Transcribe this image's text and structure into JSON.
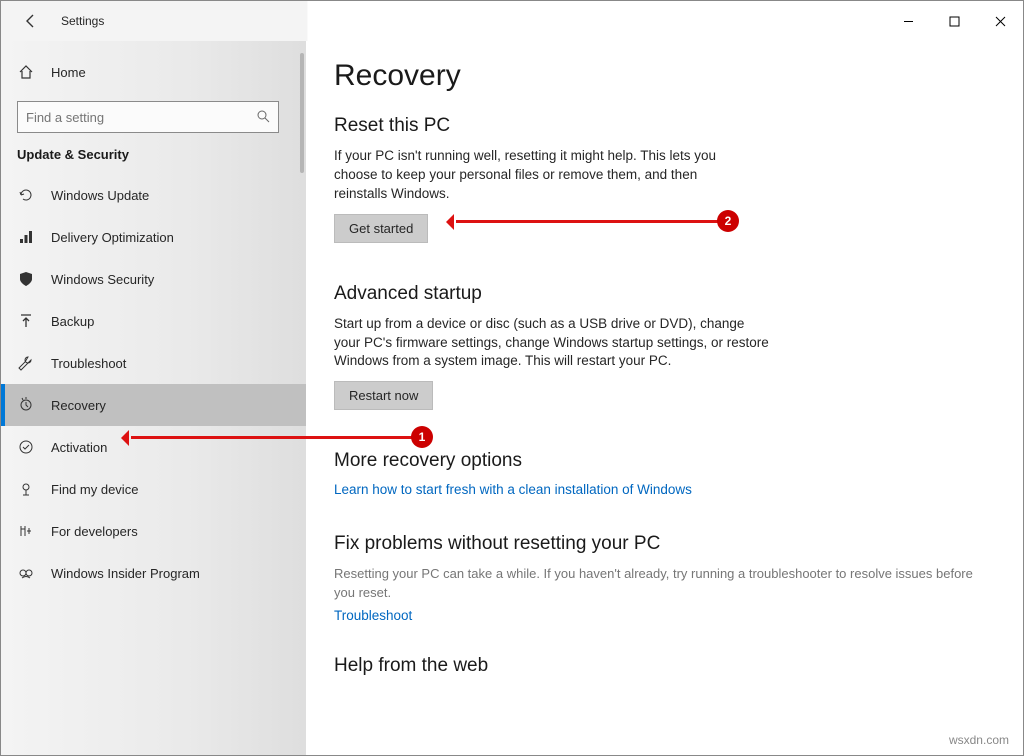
{
  "window": {
    "title": "Settings"
  },
  "sidebar": {
    "home": "Home",
    "search_placeholder": "Find a setting",
    "category": "Update & Security",
    "items": [
      {
        "label": "Windows Update"
      },
      {
        "label": "Delivery Optimization"
      },
      {
        "label": "Windows Security"
      },
      {
        "label": "Backup"
      },
      {
        "label": "Troubleshoot"
      },
      {
        "label": "Recovery"
      },
      {
        "label": "Activation"
      },
      {
        "label": "Find my device"
      },
      {
        "label": "For developers"
      },
      {
        "label": "Windows Insider Program"
      }
    ]
  },
  "page": {
    "title": "Recovery",
    "reset": {
      "heading": "Reset this PC",
      "body": "If your PC isn't running well, resetting it might help. This lets you choose to keep your personal files or remove them, and then reinstalls Windows.",
      "button": "Get started"
    },
    "advanced": {
      "heading": "Advanced startup",
      "body": "Start up from a device or disc (such as a USB drive or DVD), change your PC's firmware settings, change Windows startup settings, or restore Windows from a system image. This will restart your PC.",
      "button": "Restart now"
    },
    "more": {
      "heading": "More recovery options",
      "link": "Learn how to start fresh with a clean installation of Windows"
    },
    "fix": {
      "heading": "Fix problems without resetting your PC",
      "body": "Resetting your PC can take a while. If you haven't already, try running a troubleshooter to resolve issues before you reset.",
      "link": "Troubleshoot"
    },
    "web": {
      "heading": "Help from the web"
    }
  },
  "annotations": {
    "badge1": "1",
    "badge2": "2"
  },
  "watermark": "wsxdn.com"
}
